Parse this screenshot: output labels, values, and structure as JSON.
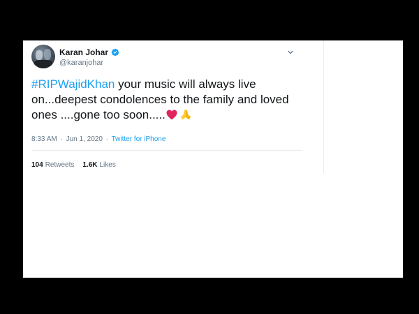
{
  "tweet": {
    "author": {
      "display_name": "Karan Johar",
      "handle": "@karanjohar",
      "verified": true
    },
    "text": {
      "hashtag": "#RIPWajidKhan",
      "body": " your music will always live on...deepest condolences to the family and loved ones ....gone too soon.....",
      "emojis": [
        "red-heart",
        "folded-hands"
      ]
    },
    "meta": {
      "time": "8:33 AM",
      "separator": "·",
      "date": "Jun 1, 2020",
      "source": "Twitter for iPhone"
    },
    "stats": {
      "retweets_count": "104",
      "retweets_label": "Retweets",
      "likes_count": "1.6K",
      "likes_label": "Likes"
    }
  },
  "colors": {
    "accent": "#1da1f2",
    "text": "#14171a",
    "muted": "#657786",
    "heart": "#e0245e"
  }
}
